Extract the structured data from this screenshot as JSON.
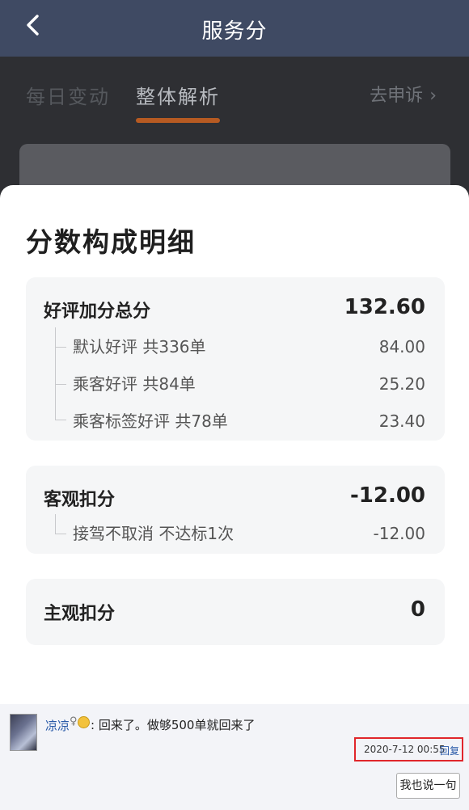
{
  "header": {
    "title": "服务分"
  },
  "tabs": [
    {
      "label": "每日变动"
    },
    {
      "label": "整体解析"
    }
  ],
  "appeal": {
    "label": "去申诉",
    "chevron": "›"
  },
  "sheet": {
    "title": "分数构成明细",
    "good": {
      "title": "好评加分总分",
      "total": "132.60",
      "items": [
        {
          "label": "默认好评 共336单",
          "value": "84.00"
        },
        {
          "label": "乘客好评 共84单",
          "value": "25.20"
        },
        {
          "label": "乘客标签好评 共78单",
          "value": "23.40"
        }
      ]
    },
    "objective": {
      "title": "客观扣分",
      "total": "-12.00",
      "items": [
        {
          "label": "接驾不取消 不达标1次",
          "value": "-12.00"
        }
      ]
    },
    "subjective": {
      "title": "主观扣分",
      "total": "0"
    }
  },
  "comment": {
    "user": "凉凉",
    "text": ": 回来了。做够500单就回来了",
    "time": "2020-7-12 00:55",
    "reply": "回复",
    "say_button": "我也说一句"
  },
  "colors": {
    "header": "#3f4a63",
    "accent": "#b65a22",
    "highlight_box": "#e0262b"
  }
}
